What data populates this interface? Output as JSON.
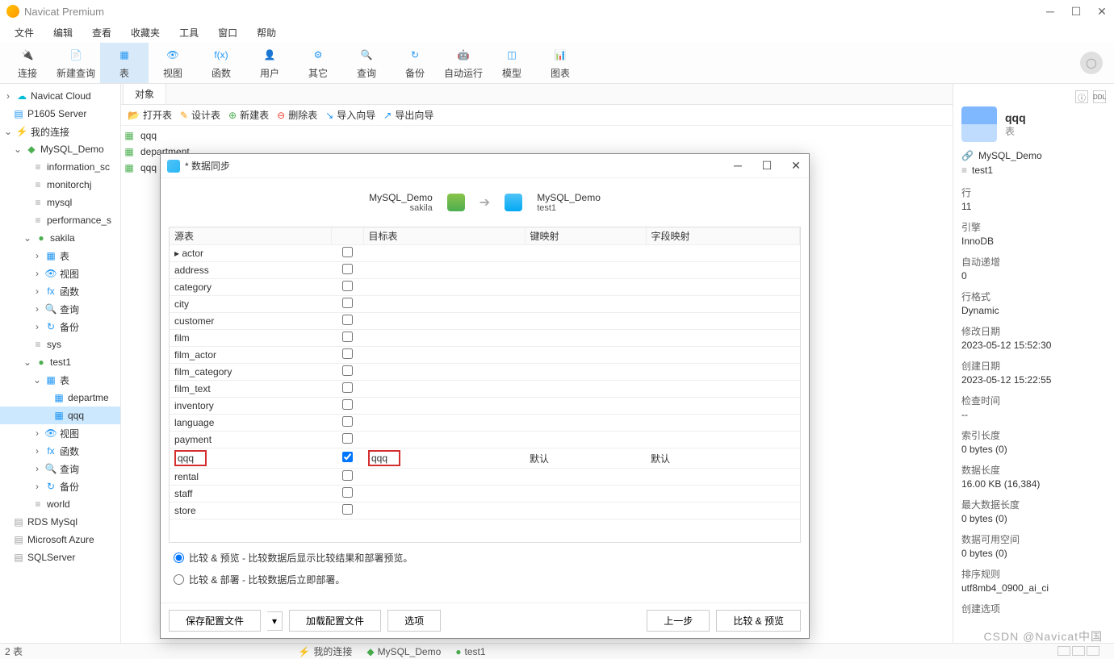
{
  "app": {
    "title": "Navicat Premium"
  },
  "menu": [
    "文件",
    "编辑",
    "查看",
    "收藏夹",
    "工具",
    "窗口",
    "帮助"
  ],
  "toolbar": [
    {
      "label": "连接",
      "icon": "plug-icon"
    },
    {
      "label": "新建查询",
      "icon": "query-icon"
    },
    {
      "label": "表",
      "icon": "table-icon",
      "active": true
    },
    {
      "label": "视图",
      "icon": "view-icon"
    },
    {
      "label": "函数",
      "icon": "fx-icon"
    },
    {
      "label": "用户",
      "icon": "user-icon"
    },
    {
      "label": "其它",
      "icon": "other-icon"
    },
    {
      "label": "查询",
      "icon": "search-icon"
    },
    {
      "label": "备份",
      "icon": "backup-icon"
    },
    {
      "label": "自动运行",
      "icon": "robot-icon"
    },
    {
      "label": "模型",
      "icon": "model-icon"
    },
    {
      "label": "图表",
      "icon": "chart-icon"
    }
  ],
  "sidebar_top": [
    {
      "label": "Navicat Cloud",
      "icon": "cloud-icon"
    },
    {
      "label": "P1605 Server",
      "icon": "server-icon"
    },
    {
      "label": "我的连接",
      "icon": "link-icon"
    }
  ],
  "tree": {
    "conn": "MySQL_Demo",
    "dbs": [
      "information_sc",
      "monitorchj",
      "mysql",
      "performance_s"
    ],
    "sakila": {
      "name": "sakila",
      "children": [
        "表",
        "视图",
        "函数",
        "查询",
        "备份"
      ]
    },
    "sys": "sys",
    "test1": {
      "name": "test1",
      "tables": [
        "departme",
        "qqq"
      ],
      "children": [
        "视图",
        "函数",
        "查询",
        "备份"
      ]
    },
    "world": "world",
    "other_conns": [
      "RDS MySql",
      "Microsoft Azure",
      "SQLServer"
    ]
  },
  "tabs": [
    "对象"
  ],
  "objtoolbar": [
    "打开表",
    "设计表",
    "新建表",
    "删除表",
    "导入向导",
    "导出向导"
  ],
  "objlist": [
    "qqq",
    "department",
    "qqq"
  ],
  "right": {
    "name": "qqq",
    "type": "表",
    "path1": "MySQL_Demo",
    "path2": "test1",
    "props": [
      {
        "k": "行",
        "v": "11"
      },
      {
        "k": "引擎",
        "v": "InnoDB"
      },
      {
        "k": "自动递增",
        "v": "0"
      },
      {
        "k": "行格式",
        "v": "Dynamic"
      },
      {
        "k": "修改日期",
        "v": "2023-05-12 15:52:30"
      },
      {
        "k": "创建日期",
        "v": "2023-05-12 15:22:55"
      },
      {
        "k": "检查时间",
        "v": "--"
      },
      {
        "k": "索引长度",
        "v": "0 bytes (0)"
      },
      {
        "k": "数据长度",
        "v": "16.00 KB (16,384)"
      },
      {
        "k": "最大数据长度",
        "v": "0 bytes (0)"
      },
      {
        "k": "数据可用空间",
        "v": "0 bytes (0)"
      },
      {
        "k": "排序规则",
        "v": "utf8mb4_0900_ai_ci"
      },
      {
        "k": "创建选项",
        "v": ""
      }
    ]
  },
  "dialog": {
    "title": "* 数据同步",
    "src": {
      "conn": "MySQL_Demo",
      "db": "sakila"
    },
    "dst": {
      "conn": "MySQL_Demo",
      "db": "test1"
    },
    "headers": [
      "源表",
      "",
      "目标表",
      "键映射",
      "字段映射"
    ],
    "rows": [
      {
        "name": "actor",
        "chk": false
      },
      {
        "name": "address",
        "chk": false
      },
      {
        "name": "category",
        "chk": false
      },
      {
        "name": "city",
        "chk": false
      },
      {
        "name": "customer",
        "chk": false
      },
      {
        "name": "film",
        "chk": false
      },
      {
        "name": "film_actor",
        "chk": false
      },
      {
        "name": "film_category",
        "chk": false
      },
      {
        "name": "film_text",
        "chk": false
      },
      {
        "name": "inventory",
        "chk": false
      },
      {
        "name": "language",
        "chk": false
      },
      {
        "name": "payment",
        "chk": false
      },
      {
        "name": "qqq",
        "chk": true,
        "target": "qqq",
        "keymap": "默认",
        "fieldmap": "默认",
        "hl": true
      },
      {
        "name": "rental",
        "chk": false
      },
      {
        "name": "staff",
        "chk": false
      },
      {
        "name": "store",
        "chk": false
      }
    ],
    "radio1": "比较 & 预览 - 比较数据后显示比较结果和部署预览。",
    "radio2": "比较 & 部署 - 比较数据后立即部署。",
    "buttons": {
      "save": "保存配置文件",
      "load": "加载配置文件",
      "options": "选项",
      "prev": "上一步",
      "next": "比较 & 预览"
    }
  },
  "status": {
    "left": "2 表",
    "conn": "我的连接",
    "db": "MySQL_Demo",
    "schema": "test1"
  },
  "watermark": "CSDN @Navicat中国"
}
